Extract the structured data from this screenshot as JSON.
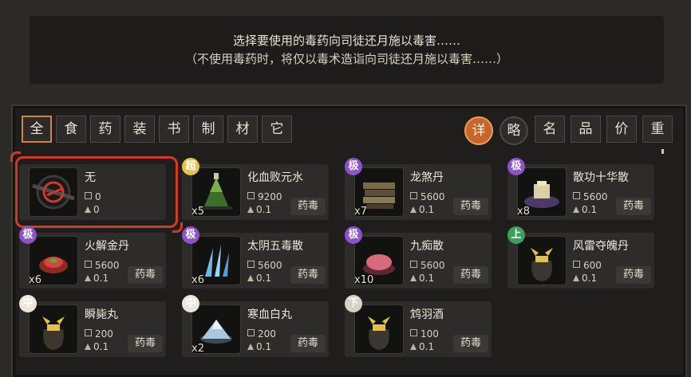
{
  "prompt": {
    "line1": "选择要使用的毒药向司徒还月施以毒害……",
    "line2": "（不使用毒药时，将仅以毒术造诣向司徒还月施以毒害……）"
  },
  "categories": [
    "全",
    "食",
    "药",
    "装",
    "书",
    "制",
    "材",
    "它"
  ],
  "active_category": "全",
  "view_modes": [
    "详",
    "略"
  ],
  "active_view": "详",
  "sort_buttons": [
    "名",
    "品",
    "价",
    "重"
  ],
  "items": [
    {
      "name": "无",
      "price": "0",
      "weight": "0",
      "qty": "",
      "badge": "",
      "tag": "",
      "icon": "none-icon"
    },
    {
      "name": "化血败元水",
      "price": "9200",
      "weight": "0.1",
      "qty": "x5",
      "badge": "超",
      "tag": "药毒",
      "icon": "green-flask-icon"
    },
    {
      "name": "龙煞丹",
      "price": "5600",
      "weight": "0.1",
      "qty": "x7",
      "badge": "极",
      "tag": "药毒",
      "icon": "stacked-scroll-icon"
    },
    {
      "name": "散功十华散",
      "price": "5600",
      "weight": "0.1",
      "qty": "x8",
      "badge": "极",
      "tag": "药毒",
      "icon": "powder-package-icon"
    },
    {
      "name": "火解金丹",
      "price": "5600",
      "weight": "0.1",
      "qty": "x6",
      "badge": "极",
      "tag": "药毒",
      "icon": "red-pill-icon"
    },
    {
      "name": "太阴五毒散",
      "price": "5600",
      "weight": "0.1",
      "qty": "x6",
      "badge": "极",
      "tag": "药毒",
      "icon": "blue-crystal-icon"
    },
    {
      "name": "九痴散",
      "price": "5600",
      "weight": "0.1",
      "qty": "x10",
      "badge": "极",
      "tag": "药毒",
      "icon": "pink-powder-icon"
    },
    {
      "name": "风雷夺魄丹",
      "price": "600",
      "weight": "0.1",
      "qty": "",
      "badge": "上",
      "tag": "药毒",
      "icon": "pouch-icon"
    },
    {
      "name": "瞬毙丸",
      "price": "200",
      "weight": "0.1",
      "qty": "",
      "badge": "中",
      "tag": "药毒",
      "icon": "pouch-icon"
    },
    {
      "name": "寒血白丸",
      "price": "200",
      "weight": "0.1",
      "qty": "x2",
      "badge": "中",
      "tag": "药毒",
      "icon": "white-powder-icon"
    },
    {
      "name": "鸩羽酒",
      "price": "100",
      "weight": "0.1",
      "qty": "",
      "badge": "下",
      "tag": "药毒",
      "icon": "pouch-icon"
    }
  ],
  "colors": {
    "accent": "#d0862c",
    "selection": "#d23a26",
    "grade_super": "#e6c24a",
    "grade_extreme": "#8c52c9",
    "grade_upper": "#3aa05a"
  }
}
